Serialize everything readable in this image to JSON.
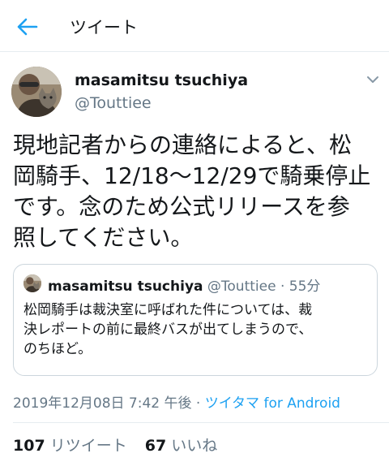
{
  "header": {
    "title": "ツイート",
    "back_icon": "arrow-left-icon",
    "accent": "#1da1f2"
  },
  "author": {
    "display_name": "masamitsu tsuchiya",
    "handle": "@Touttiee",
    "avatar_icon": "avatar-photo-cat-icon"
  },
  "tweet": {
    "lines": [
      "現地記者からの連絡によると、松",
      "岡騎手、12/18〜12/29で騎乗停止",
      "です。念のため公式リリースを参",
      "照してください。"
    ],
    "timestamp": "2019年12月08日 7:42 午後 · ",
    "source": "ツイタマ for Android"
  },
  "quote": {
    "display_name": "masamitsu tsuchiya",
    "handle": "@Touttiee",
    "separator": "·",
    "time": "55分",
    "lines": [
      "松岡騎手は裁決室に呼ばれた件については、裁",
      "決レポートの前に最終バスが出てしまうので、",
      "のちほど。"
    ]
  },
  "stats": {
    "retweets": "107",
    "retweets_label": "リツイート",
    "likes": "67",
    "likes_label": "いいね"
  }
}
